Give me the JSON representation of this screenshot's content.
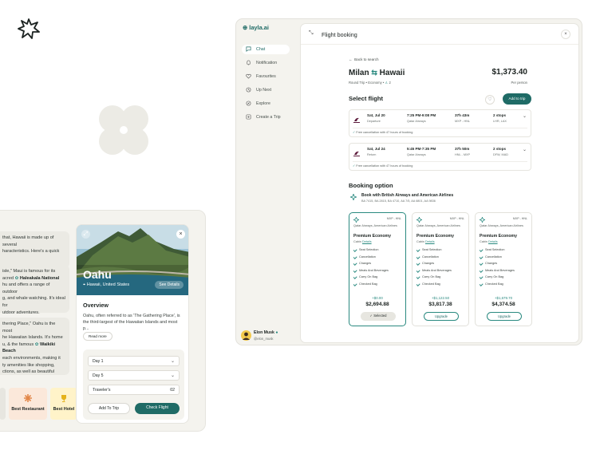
{
  "colors": {
    "accent": "#1f6b66",
    "accent_light": "#2a8a80",
    "canvas": "#f4f3ee",
    "restaurant": "#fbe8da",
    "hotel": "#fff3c9"
  },
  "left": {
    "chat": [
      {
        "text": "that, Hawaii is made up of several"
      },
      {
        "text": "haracteristics. Here's a quick"
      }
    ],
    "maui": {
      "l1": "isle,\" Maui is famous for its",
      "l2a": "acred",
      "l2b": "Haleakala National",
      "l3": "hu and offers a range of outdoor",
      "l4": "g, and whale watching. It's ideal for",
      "l5": "utdoor adventures."
    },
    "oahu_text": {
      "l1": "thering Place,\" Oahu is the most",
      "l2": "he Hawaiian Islands. It's home",
      "l3a": "u, & the famous",
      "l3b": "Waikiki Beach",
      "l4": "each environments, making it",
      "l5": "ty amenities like shopping,",
      "l6": "ctions, as well as beautiful"
    },
    "best_restaurant": "Best Restaurant",
    "best_hotel": "Best Hotel",
    "oahu": {
      "title": "Oahu",
      "location": "Hawaii, United States",
      "chip": "See Details",
      "overview_h": "Overview",
      "overview_p": "Oahu, often referred to as 'The Gathering Place', is the third-largest of the Hawaiian Islands and most p...",
      "read_more": "Read more",
      "day1": "Day 1",
      "day5": "Day 5",
      "travelers_label": "Traveler's",
      "travelers_value": "02",
      "add_to_trip": "Add To Trip",
      "check_flight": "Check Flight"
    }
  },
  "app": {
    "brand": "layla.ai",
    "nav": [
      {
        "label": "Chat",
        "icon": "chat-icon"
      },
      {
        "label": "Notification",
        "icon": "bell-icon"
      },
      {
        "label": "Favourites",
        "icon": "heart-icon"
      },
      {
        "label": "Up Next",
        "icon": "up-next-icon"
      },
      {
        "label": "Explore",
        "icon": "compass-icon"
      },
      {
        "label": "Create a Trip",
        "icon": "plus-icon"
      }
    ],
    "user": {
      "name": "Elon Musk",
      "handle": "@elon_musk"
    },
    "panel": {
      "title": "Flight booking",
      "back": "Back to search",
      "from": "Milan",
      "to": "Hawaii",
      "meta_trip": "Round Trip",
      "meta_class": "Economy",
      "meta_pax": "2",
      "price": "$1,373.40",
      "per_person": "Per person",
      "select_flight": "Select flight",
      "add_to_trip": "Add to trip",
      "flights": [
        {
          "date": "Sat, Jul 20",
          "dir": "Departure",
          "time": "7:25 PM-9:08 PM",
          "airline": "Qatar Airways",
          "dur": "37h 43m",
          "route": "MXP - HNL",
          "stops": "2 stops",
          "via": "LHR, LAX",
          "note": "Free cancellation with 47 hours of booking"
        },
        {
          "date": "Sat, Jul 24",
          "dir": "Return",
          "time": "5:45 PM-7:35 PM",
          "airline": "Qatar Airways",
          "dur": "37h 50m",
          "route": "HNL - MXP",
          "stops": "2 stops",
          "via": "DFW, MAD",
          "note": "Free cancellation with 47 hours of booking"
        }
      ],
      "booking_option": "Booking option",
      "book_with": "Book with British Airways and American Airlines",
      "flight_codes": "BA 7415, BA 2815, BA 4710, AA 7/5, AA 6801, AA 9836",
      "fares": [
        {
          "cls": "MXP - HNL",
          "airline": "Qatar Airways, American Airlines",
          "name": "Premium Economy",
          "cabin_label": "Cabin",
          "cabin_link": "Details",
          "features": [
            "Seat Selection",
            "Cancellation",
            "Changes",
            "Meals And Beverages",
            "Carry On Bag",
            "Checked Bag"
          ],
          "delta": "+$0.00",
          "total": "$2,694.88",
          "button": "Selected"
        },
        {
          "cls": "MXP - HNL",
          "airline": "Qatar Airways, American Airlines",
          "name": "Premium Economy",
          "cabin_label": "Cabin",
          "cabin_link": "Details",
          "features": [
            "Seat Selection",
            "Cancellation",
            "Changes",
            "Meals And Beverages",
            "Carry On Bag",
            "Checked Bag"
          ],
          "delta": "+$1,122.50",
          "total": "$3,817.38",
          "button": "Upgrade"
        },
        {
          "cls": "MXP - HNL",
          "airline": "Qatar Airways, American Airlines",
          "name": "Premium Economy",
          "cabin_label": "Cabin",
          "cabin_link": "Details",
          "features": [
            "Seat Selection",
            "Cancellation",
            "Changes",
            "Meals And Beverages",
            "Carry On Bag",
            "Checked Bag"
          ],
          "delta": "+$1,679.70",
          "total": "$4,374.58",
          "button": "Upgrade"
        }
      ]
    }
  }
}
